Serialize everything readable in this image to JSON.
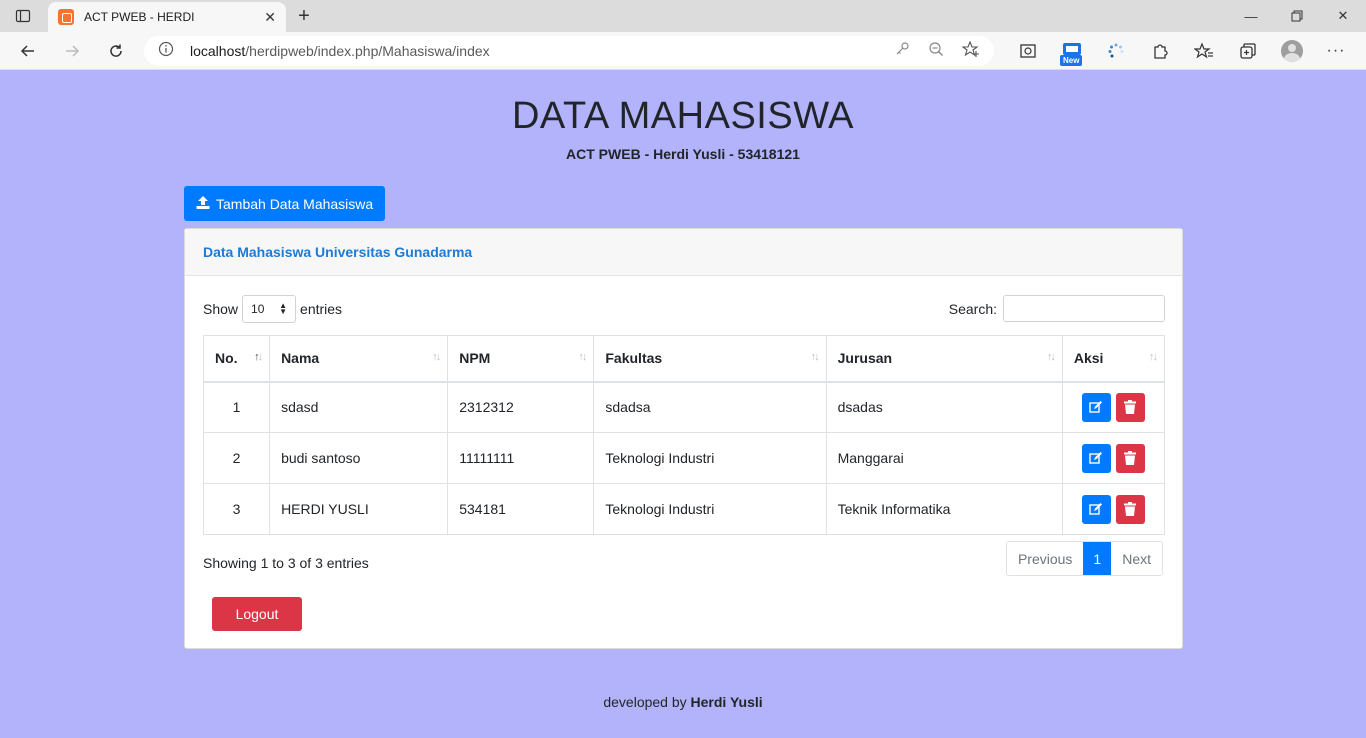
{
  "browser": {
    "tab_title": "ACT PWEB - HERDI",
    "url_host": "localhost",
    "url_path": "/herdipweb/index.php/Mahasiswa/index",
    "new_badge": "New"
  },
  "page": {
    "title": "DATA MAHASISWA",
    "subtitle": "ACT PWEB - Herdi Yusli - 53418121",
    "add_button_label": "Tambah Data Mahasiswa"
  },
  "card": {
    "header_title": "Data Mahasiswa Universitas Gunadarma"
  },
  "datatable": {
    "show_label": "Show",
    "entries_label": "entries",
    "length_value": "10",
    "search_label": "Search:",
    "search_value": "",
    "columns": [
      "No.",
      "Nama",
      "NPM",
      "Fakultas",
      "Jurusan",
      "Aksi"
    ],
    "rows": [
      {
        "no": "1",
        "nama": "sdasd",
        "npm": "2312312",
        "fakultas": "sdadsa",
        "jurusan": "dsadas"
      },
      {
        "no": "2",
        "nama": "budi santoso",
        "npm": "11111111",
        "fakultas": "Teknologi Industri",
        "jurusan": "Manggarai"
      },
      {
        "no": "3",
        "nama": "HERDI YUSLI",
        "npm": "534181",
        "fakultas": "Teknologi Industri",
        "jurusan": "Teknik Informatika"
      }
    ],
    "info": "Showing 1 to 3 of 3 entries",
    "pagination": {
      "previous": "Previous",
      "current": "1",
      "next": "Next"
    }
  },
  "logout_label": "Logout",
  "footer": {
    "prefix": "developed by",
    "author": "Herdi Yusli"
  },
  "colors": {
    "background": "#b3b3fb",
    "primary": "#007bff",
    "danger": "#dc3545"
  }
}
